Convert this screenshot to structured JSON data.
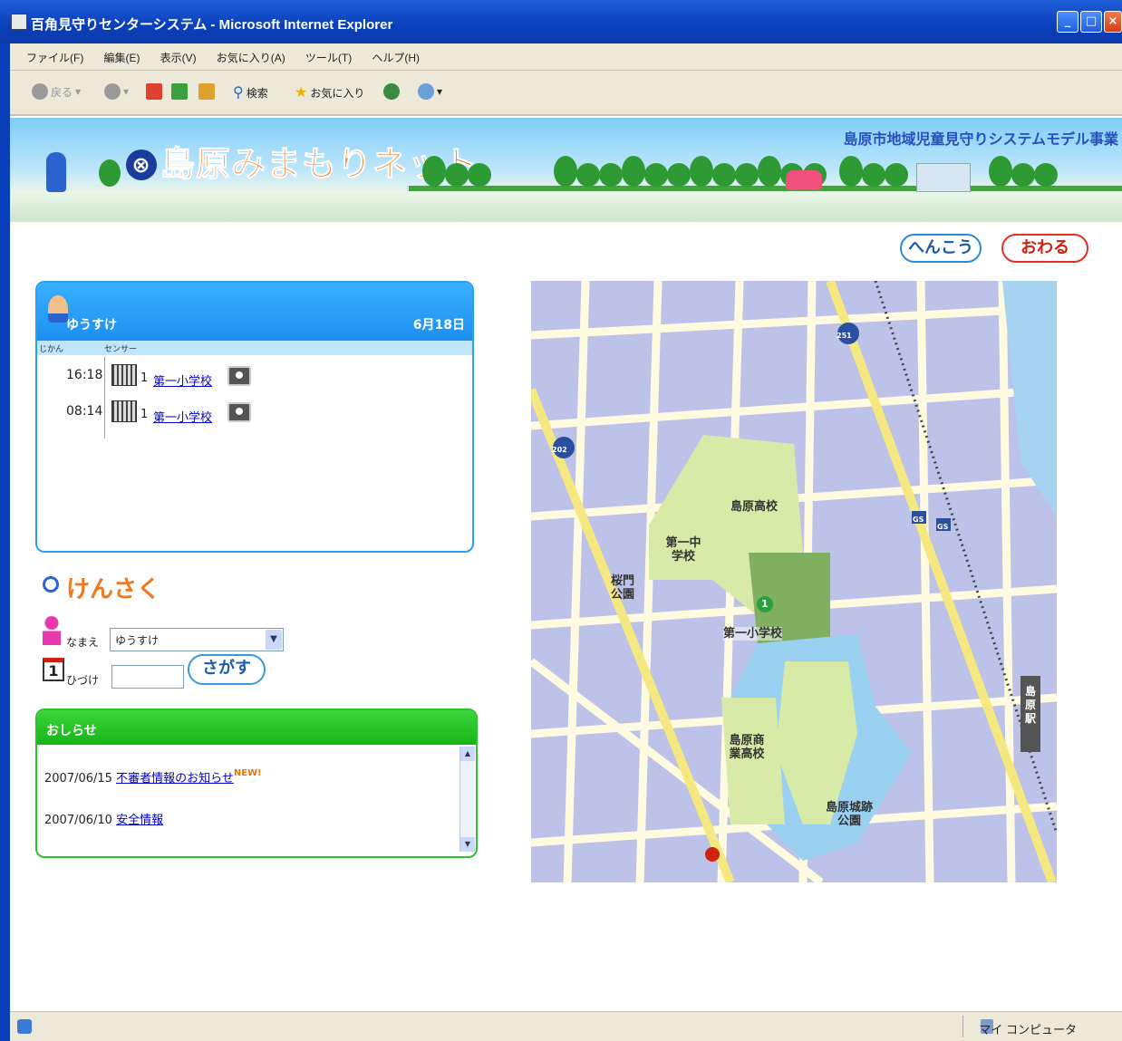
{
  "window": {
    "title": "百角見守りセンターシステム - Microsoft Internet Explorer"
  },
  "menu": [
    "ファイル(F)",
    "編集(E)",
    "表示(V)",
    "お気に入り(A)",
    "ツール(T)",
    "ヘルプ(H)"
  ],
  "toolbar": {
    "back": "戻る",
    "search": "検索",
    "favorites": "お気に入り"
  },
  "banner": {
    "logo": "島原みまもりネット",
    "subtitle": "島原市地域児童見守りシステムモデル事業"
  },
  "buttons": {
    "change": "へんこう",
    "exit": "おわる"
  },
  "child_panel": {
    "name": "ゆうすけ",
    "date": "6月18日",
    "col_time": "じかん",
    "col_sensor": "センサー",
    "rows": [
      {
        "time": "16:18",
        "num": "1",
        "place": "第一小学校"
      },
      {
        "time": "08:14",
        "num": "1",
        "place": "第一小学校"
      }
    ]
  },
  "search": {
    "title": "けんさく",
    "name_label": "なまえ",
    "name_value": "ゆうすけ",
    "date_label": "ひづけ",
    "date_value": "",
    "button": "さがす"
  },
  "notice": {
    "title": "おしらせ",
    "new_badge": "NEW!",
    "items": [
      {
        "date": "2007/06/15",
        "text": "不審者情報のお知らせ"
      },
      {
        "date": "2007/06/10",
        "text": "安全情報"
      }
    ]
  },
  "map": {
    "labels": {
      "hs": "島原高校",
      "jhs": "第一中学校",
      "park1": "桜門公園",
      "school": "第一小学校",
      "commercial": "島原商業高校",
      "castle": "島原城跡公園",
      "station": "島原駅"
    },
    "route1": "251",
    "route2": "202",
    "marker": "1",
    "gs1": "GS",
    "gs2": "GS"
  },
  "status": {
    "zone": "マイ コンピュータ"
  }
}
